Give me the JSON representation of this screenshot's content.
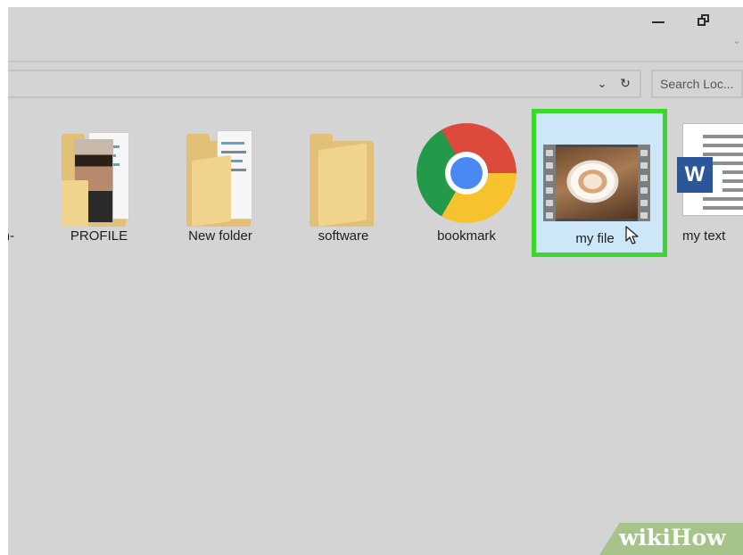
{
  "window": {
    "minimize_glyph": "—",
    "restore_glyph": "❐"
  },
  "address_bar": {
    "dropdown_glyph": "⌄",
    "refresh_glyph": "↻"
  },
  "search": {
    "placeholder": "Search Loc..."
  },
  "items": [
    {
      "label": "n-",
      "type": "folder"
    },
    {
      "label": "PROFILE",
      "type": "folder-with-photo"
    },
    {
      "label": "New folder",
      "type": "folder-with-documents"
    },
    {
      "label": "software",
      "type": "folder"
    },
    {
      "label": "bookmark",
      "type": "chrome-shortcut"
    },
    {
      "label": "my file",
      "type": "video",
      "selected": true
    },
    {
      "label": "my text",
      "type": "word-document"
    }
  ],
  "word_badge": "W",
  "watermark": {
    "wiki": "wiki",
    "how": "How"
  },
  "colors": {
    "selection_border": "#3bd72a",
    "selection_fill": "#cde7f8",
    "folder": "#e2c077",
    "word_blue": "#2b579a"
  }
}
